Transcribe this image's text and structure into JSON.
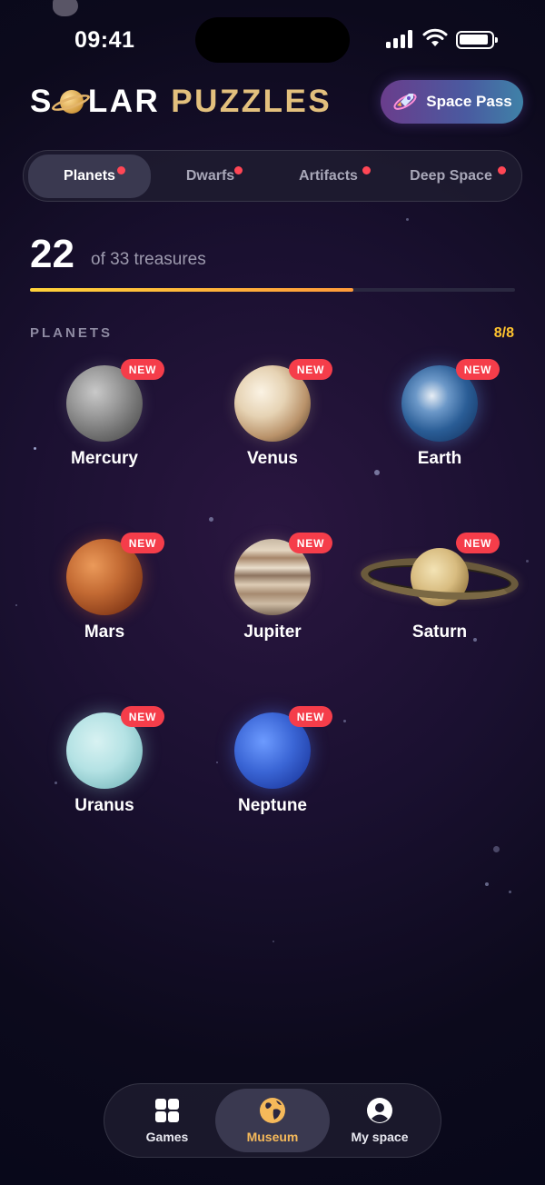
{
  "status_bar": {
    "time": "09:41"
  },
  "header": {
    "title_part1": "S",
    "title_part1b": "LAR",
    "title_part2": "PUZZLES",
    "space_pass_label": "Space Pass"
  },
  "tabs": [
    {
      "label": "Planets",
      "active": true,
      "has_dot": true
    },
    {
      "label": "Dwarfs",
      "active": false,
      "has_dot": true
    },
    {
      "label": "Artifacts",
      "active": false,
      "has_dot": true
    },
    {
      "label": "Deep Space",
      "active": false,
      "has_dot": true
    }
  ],
  "progress": {
    "collected": "22",
    "total_text": "of 33 treasures",
    "fraction": 0.667
  },
  "section": {
    "title": "PLANETS",
    "count": "8/8"
  },
  "planets": [
    {
      "name": "Mercury",
      "badge": "NEW",
      "icon": "mercury-icon"
    },
    {
      "name": "Venus",
      "badge": "NEW",
      "icon": "venus-icon"
    },
    {
      "name": "Earth",
      "badge": "NEW",
      "icon": "earth-icon"
    },
    {
      "name": "Mars",
      "badge": "NEW",
      "icon": "mars-icon"
    },
    {
      "name": "Jupiter",
      "badge": "NEW",
      "icon": "jupiter-icon"
    },
    {
      "name": "Saturn",
      "badge": "NEW",
      "icon": "saturn-icon"
    },
    {
      "name": "Uranus",
      "badge": "NEW",
      "icon": "uranus-icon"
    },
    {
      "name": "Neptune",
      "badge": "NEW",
      "icon": "neptune-icon"
    }
  ],
  "nav": [
    {
      "label": "Games",
      "icon": "grid-icon",
      "active": false
    },
    {
      "label": "Museum",
      "icon": "globe-icon",
      "active": true
    },
    {
      "label": "My space",
      "icon": "user-icon",
      "active": false
    }
  ],
  "colors": {
    "accent_gold": "#e3c07d",
    "badge_red": "#f53d4a",
    "progress_yellow": "#ffd23a",
    "active_nav": "#f5b95a"
  }
}
